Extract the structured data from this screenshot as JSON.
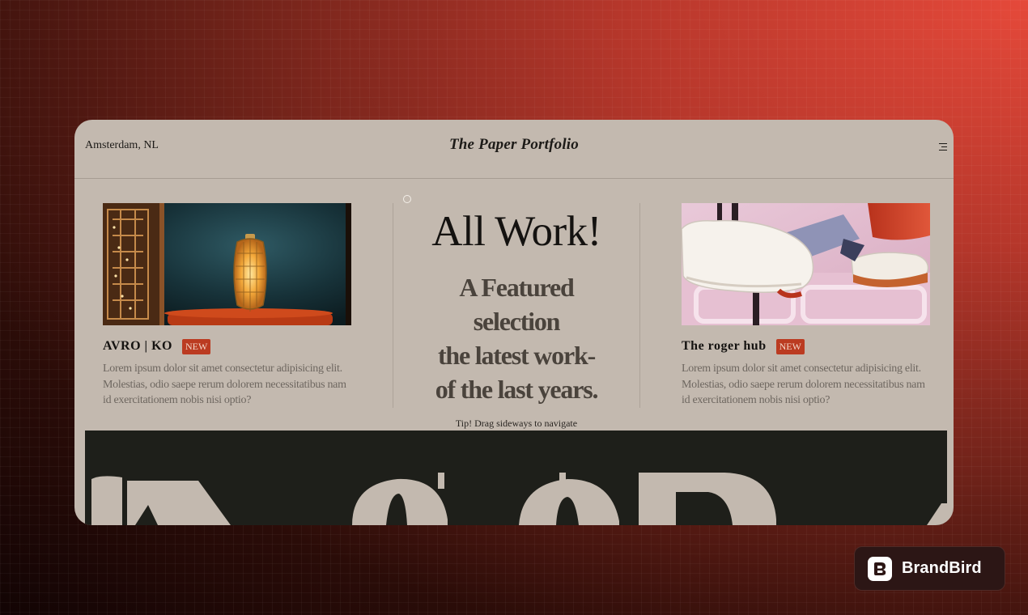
{
  "header": {
    "location": "Amsterdam, NL",
    "site_title": "The Paper Portfolio",
    "menu_icon": "menu-icon"
  },
  "projects": [
    {
      "title": "AVRO | KO",
      "badge": "NEW",
      "description": "Lorem ipsum dolor sit amet consectetur adipisicing elit. Molestias, odio saepe rerum dolorem necessitatibus nam id exercitationem nobis nisi optio?",
      "image": "lantern-photo"
    },
    {
      "title": "The roger hub",
      "badge": "NEW",
      "description": "Lorem ipsum dolor sit amet consectetur adipisicing elit. Molestias, odio saepe rerum dolorem necessitatibus nam id exercitationem nobis nisi optio?",
      "image": "sneakers-photo"
    }
  ],
  "intro": {
    "heading": "All Work!",
    "subtitle_lines": [
      "A Featured",
      "selection",
      "the latest work-",
      "of the last years."
    ],
    "tip": "Tip! Drag sideways to navigate"
  },
  "watermark": {
    "brand": "BrandBird"
  },
  "colors": {
    "card_background": "#c3b9af",
    "badge": "#bb3b21",
    "dark_band": "#1e1f1a"
  }
}
